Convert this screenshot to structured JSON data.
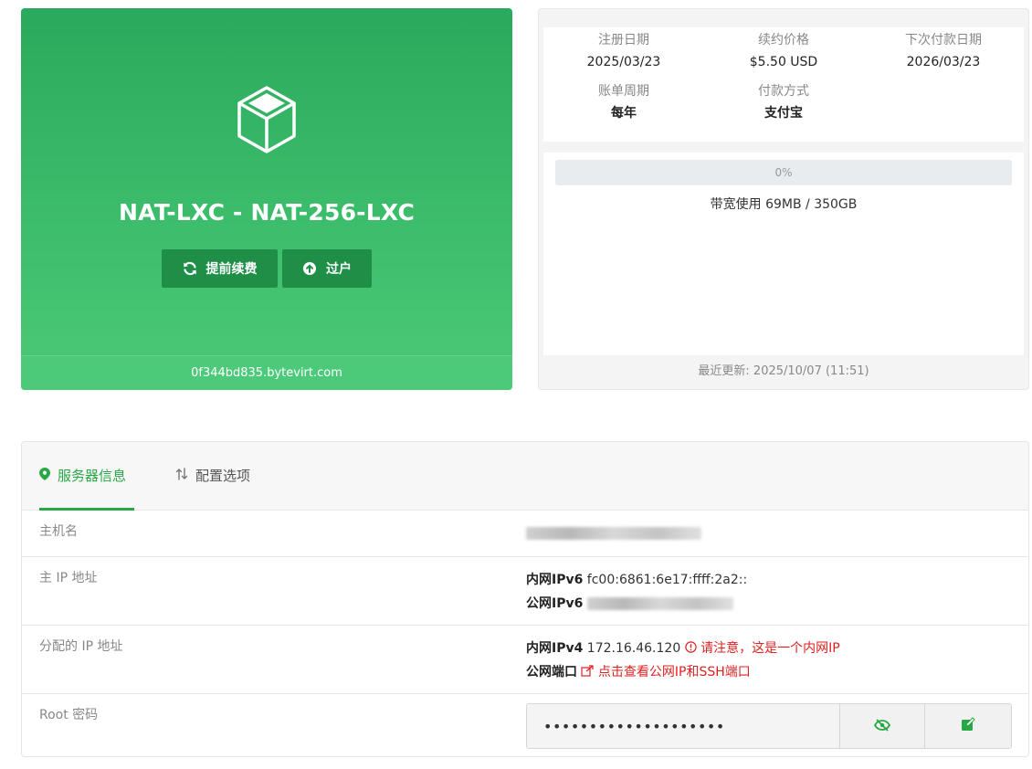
{
  "product": {
    "title": "NAT-LXC - NAT-256-LXC",
    "renew_label": "提前续费",
    "transfer_label": "过户",
    "domain": "0f344bd835.bytevirt.com",
    "icon": "cube-icon"
  },
  "billing": {
    "reg_date_label": "注册日期",
    "reg_date": "2025/03/23",
    "renew_price_label": "续约价格",
    "renew_price": "$5.50 USD",
    "next_due_label": "下次付款日期",
    "next_due": "2026/03/23",
    "cycle_label": "账单周期",
    "cycle": "每年",
    "payment_label": "付款方式",
    "payment": "支付宝",
    "usage_percent": "0%",
    "bandwidth": "带宽使用 69MB / 350GB",
    "updated": "最近更新: 2025/10/07 (11:51)"
  },
  "tabs": {
    "server_info": "服务器信息",
    "config": "配置选项"
  },
  "server": {
    "hostname_label": "主机名",
    "primary_ip_label": "主 IP 地址",
    "inner_ipv6_label": "内网IPv6",
    "inner_ipv6": "fc00:6861:6e17:ffff:2a2::",
    "public_ipv6_label": "公网IPv6",
    "assigned_ip_label": "分配的 IP 地址",
    "inner_ipv4_label": "内网IPv4",
    "inner_ipv4": "172.16.46.120",
    "inner_ip_warning": "请注意，这是一个内网IP",
    "public_port_label": "公网端口",
    "public_port_link": "点击查看公网IP和SSH端口",
    "root_pw_label": "Root 密码",
    "root_pw_value": "••••••••••••••••••••"
  },
  "colors": {
    "brand_green": "#28a745",
    "warning_red": "#e02020"
  }
}
